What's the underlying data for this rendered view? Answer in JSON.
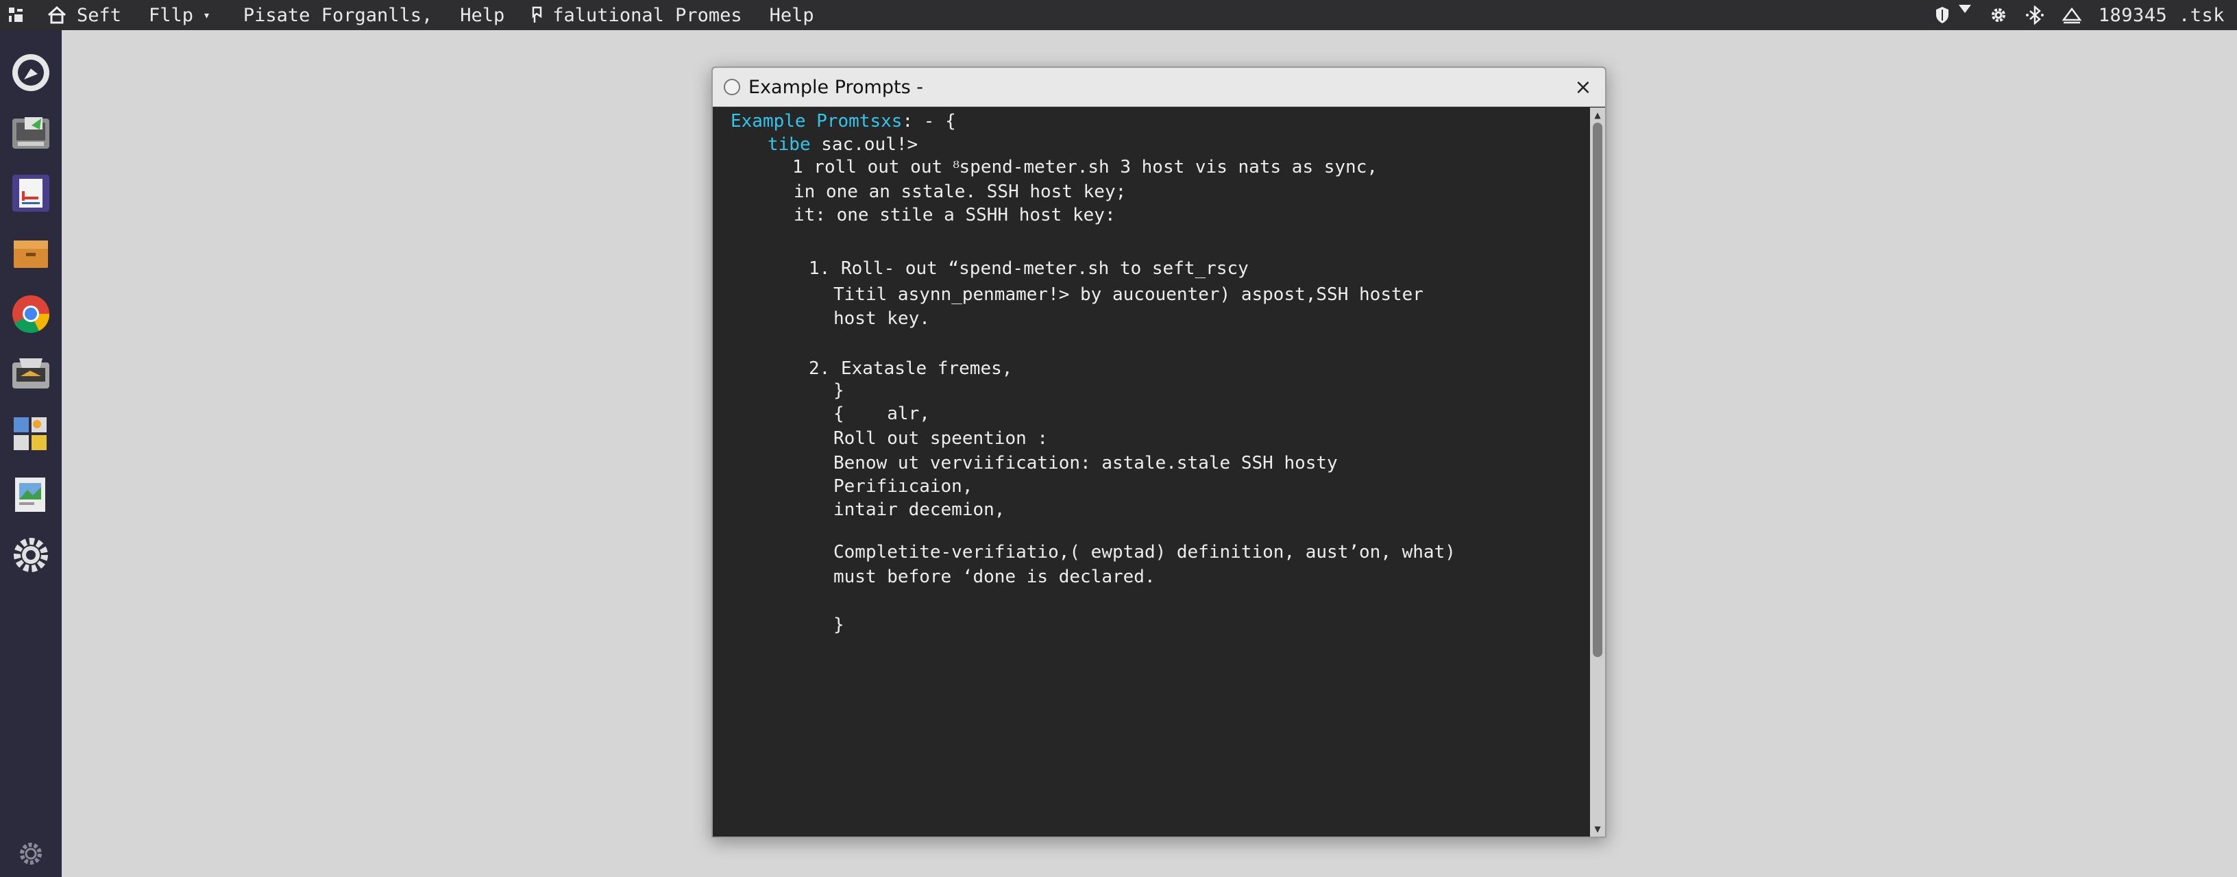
{
  "topbar": {
    "menu": [
      {
        "label": "Seft"
      },
      {
        "label": "Fllp"
      },
      {
        "label": "Pisate Forganlls,"
      },
      {
        "label": "Help"
      },
      {
        "label": "falutional Promes"
      },
      {
        "label": "Help"
      }
    ],
    "caret": "▾",
    "clock": "189345 .tsk"
  },
  "window": {
    "title": "Example Prompts -",
    "close": "×",
    "lines": [
      {
        "prefix": "Example Promtsxs",
        "text": ": - {"
      },
      {
        "prefix": "tibe",
        "text": " sac.oul!>"
      },
      {
        "text": "1 roll out out ᴽspend-meter.sh 3 host vis nats as sync,"
      },
      {
        "text": "in one an sstale. SSH host key;"
      },
      {
        "text": "it: one stile a SSHH host key:"
      },
      {
        "text": "1. Roll- out “spend-meter.sh to seft_rscy"
      },
      {
        "text": "Titil asynn_penmamer!> by aucouenter) aspost,SSH hoster"
      },
      {
        "text": "host key."
      },
      {
        "text": "2. Exatasle fremes,"
      },
      {
        "text": "}"
      },
      {
        "text": "{    alr,"
      },
      {
        "text": "Roll out speention :"
      },
      {
        "text": "Benow ut verviification: astale.stale SSH hosty"
      },
      {
        "text": "Perifiıcaion,"
      },
      {
        "text": "intair decemion,"
      },
      {
        "text": "Completite-verifiatio,( ewptad) definition, aust’on, what)"
      },
      {
        "text": "must before ‘done is declared."
      },
      {
        "text": "}"
      }
    ]
  },
  "colors": {
    "accent": "#35c4ea",
    "terminal_bg": "#262626",
    "panel_bg": "#2e2e30",
    "dock_bg": "#2c2b3d"
  },
  "icons": {
    "menu_home": "home-icon",
    "menu_doc": "document-icon",
    "tray": [
      "shield-icon",
      "wifi-icon",
      "gear-icon",
      "bluetooth-icon",
      "eject-icon"
    ],
    "dock": [
      "chat-icon",
      "printer-icon",
      "text-editor-icon",
      "archive-icon",
      "chrome-icon",
      "scanner-icon",
      "apps-grid-icon",
      "image-viewer-icon",
      "settings-icon",
      "gear-icon"
    ]
  }
}
